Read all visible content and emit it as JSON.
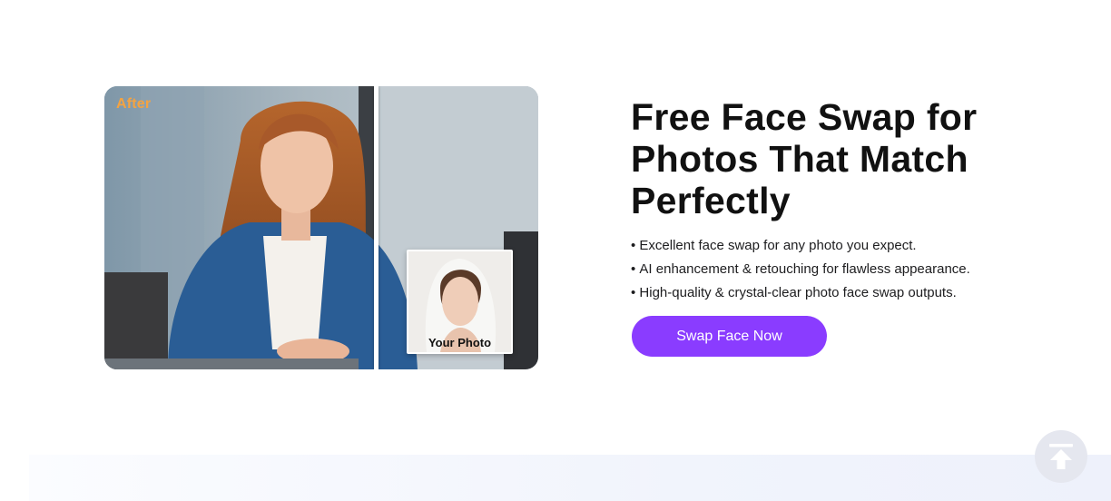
{
  "showcase": {
    "result_label": "After",
    "source_label": "Your Photo"
  },
  "headline": "Free Face Swap for Photos That Match Perfectly",
  "features": [
    "Excellent face swap for any photo you expect.",
    "AI enhancement & retouching for flawless appearance.",
    "High-quality & crystal-clear photo face swap outputs."
  ],
  "cta": {
    "label": "Swap Face Now"
  },
  "colors": {
    "accent": "#8a3cff",
    "label_orange": "#f5a340",
    "text": "#111111"
  },
  "icons": {
    "back_to_top": "arrow-up-to-line-icon"
  }
}
